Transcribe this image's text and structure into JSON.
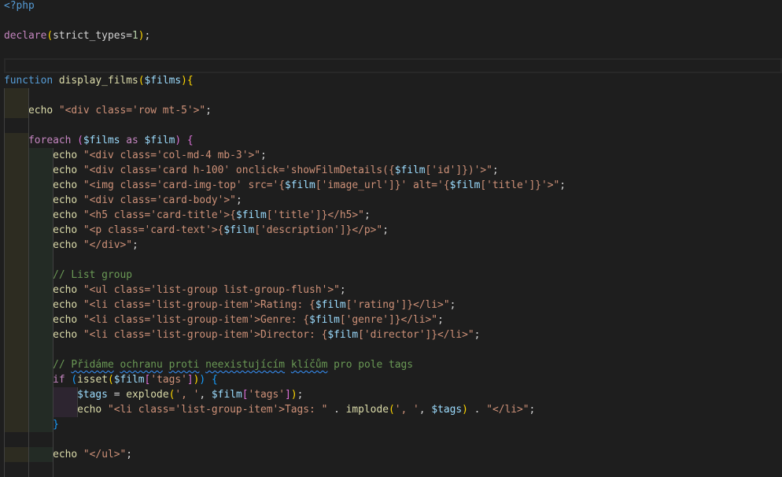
{
  "editor": {
    "current_line": 4,
    "lines": [
      {
        "ind": 0,
        "t": [
          [
            "b",
            "<?php"
          ]
        ]
      },
      {
        "ind": 0,
        "t": []
      },
      {
        "ind": 0,
        "t": [
          [
            "k",
            "declare"
          ],
          [
            "g",
            "("
          ],
          [
            "p",
            "strict_types="
          ],
          [
            "n",
            "1"
          ],
          [
            "g",
            ")"
          ],
          [
            "p",
            ";"
          ]
        ]
      },
      {
        "ind": 0,
        "t": []
      },
      {
        "ind": 0,
        "t": []
      },
      {
        "ind": 0,
        "t": [
          [
            "b",
            "function"
          ],
          [
            "p",
            " "
          ],
          [
            "f",
            "display_films"
          ],
          [
            "g",
            "("
          ],
          [
            "v",
            "$films"
          ],
          [
            "g",
            ")"
          ],
          [
            "g",
            "{"
          ]
        ]
      },
      {
        "ind": 1,
        "t": []
      },
      {
        "ind": 1,
        "t": [
          [
            "p",
            "    "
          ],
          [
            "e",
            "echo"
          ],
          [
            "p",
            " "
          ],
          [
            "s",
            "\"<div class='row mt-5'>\""
          ],
          [
            "p",
            ";"
          ]
        ]
      },
      {
        "ind": 0,
        "t": []
      },
      {
        "ind": 1,
        "t": [
          [
            "p",
            "    "
          ],
          [
            "k",
            "foreach"
          ],
          [
            "p",
            " "
          ],
          [
            "m",
            "("
          ],
          [
            "v",
            "$films"
          ],
          [
            "p",
            " "
          ],
          [
            "k",
            "as"
          ],
          [
            "p",
            " "
          ],
          [
            "v",
            "$film"
          ],
          [
            "m",
            ")"
          ],
          [
            "p",
            " "
          ],
          [
            "m",
            "{"
          ]
        ]
      },
      {
        "ind": 2,
        "t": [
          [
            "p",
            "        "
          ],
          [
            "e",
            "echo"
          ],
          [
            "p",
            " "
          ],
          [
            "s",
            "\"<div class='col-md-4 mb-3'>\""
          ],
          [
            "p",
            ";"
          ]
        ]
      },
      {
        "ind": 2,
        "t": [
          [
            "p",
            "        "
          ],
          [
            "e",
            "echo"
          ],
          [
            "p",
            " "
          ],
          [
            "s",
            "\"<div class='card h-100' onclick='showFilmDetails({"
          ],
          [
            "v",
            "$film"
          ],
          [
            "s",
            "['id']})'>\""
          ],
          [
            "p",
            ";"
          ]
        ]
      },
      {
        "ind": 2,
        "t": [
          [
            "p",
            "        "
          ],
          [
            "e",
            "echo"
          ],
          [
            "p",
            " "
          ],
          [
            "s",
            "\"<img class='card-img-top' src='{"
          ],
          [
            "v",
            "$film"
          ],
          [
            "s",
            "['image_url']}' alt='{"
          ],
          [
            "v",
            "$film"
          ],
          [
            "s",
            "['title']}'>\""
          ],
          [
            "p",
            ";"
          ]
        ]
      },
      {
        "ind": 2,
        "t": [
          [
            "p",
            "        "
          ],
          [
            "e",
            "echo"
          ],
          [
            "p",
            " "
          ],
          [
            "s",
            "\"<div class='card-body'>\""
          ],
          [
            "p",
            ";"
          ]
        ]
      },
      {
        "ind": 2,
        "t": [
          [
            "p",
            "        "
          ],
          [
            "e",
            "echo"
          ],
          [
            "p",
            " "
          ],
          [
            "s",
            "\"<h5 class='card-title'>{"
          ],
          [
            "v",
            "$film"
          ],
          [
            "s",
            "['title']}</h5>\""
          ],
          [
            "p",
            ";"
          ]
        ]
      },
      {
        "ind": 2,
        "t": [
          [
            "p",
            "        "
          ],
          [
            "e",
            "echo"
          ],
          [
            "p",
            " "
          ],
          [
            "s",
            "\"<p class='card-text'>{"
          ],
          [
            "v",
            "$film"
          ],
          [
            "s",
            "['description']}</p>\""
          ],
          [
            "p",
            ";"
          ]
        ]
      },
      {
        "ind": 2,
        "t": [
          [
            "p",
            "        "
          ],
          [
            "e",
            "echo"
          ],
          [
            "p",
            " "
          ],
          [
            "s",
            "\"</div>\""
          ],
          [
            "p",
            ";"
          ]
        ]
      },
      {
        "ind": 2,
        "t": []
      },
      {
        "ind": 2,
        "t": [
          [
            "p",
            "        "
          ],
          [
            "c",
            "// List group"
          ]
        ]
      },
      {
        "ind": 2,
        "t": [
          [
            "p",
            "        "
          ],
          [
            "e",
            "echo"
          ],
          [
            "p",
            " "
          ],
          [
            "s",
            "\"<ul class='list-group list-group-flush'>\""
          ],
          [
            "p",
            ";"
          ]
        ]
      },
      {
        "ind": 2,
        "t": [
          [
            "p",
            "        "
          ],
          [
            "e",
            "echo"
          ],
          [
            "p",
            " "
          ],
          [
            "s",
            "\"<li class='list-group-item'>Rating: {"
          ],
          [
            "v",
            "$film"
          ],
          [
            "s",
            "['rating']}</li>\""
          ],
          [
            "p",
            ";"
          ]
        ]
      },
      {
        "ind": 2,
        "t": [
          [
            "p",
            "        "
          ],
          [
            "e",
            "echo"
          ],
          [
            "p",
            " "
          ],
          [
            "s",
            "\"<li class='list-group-item'>Genre: {"
          ],
          [
            "v",
            "$film"
          ],
          [
            "s",
            "['genre']}</li>\""
          ],
          [
            "p",
            ";"
          ]
        ]
      },
      {
        "ind": 2,
        "t": [
          [
            "p",
            "        "
          ],
          [
            "e",
            "echo"
          ],
          [
            "p",
            " "
          ],
          [
            "s",
            "\"<li class='list-group-item'>Director: {"
          ],
          [
            "v",
            "$film"
          ],
          [
            "s",
            "['director']}</li>\""
          ],
          [
            "p",
            ";"
          ]
        ]
      },
      {
        "ind": 2,
        "t": []
      },
      {
        "ind": 2,
        "t": [
          [
            "p",
            "        "
          ],
          [
            "c",
            "// "
          ],
          [
            "sq",
            "Přidáme"
          ],
          [
            "c",
            " "
          ],
          [
            "sq",
            "ochranu"
          ],
          [
            "c",
            " "
          ],
          [
            "sq",
            "proti"
          ],
          [
            "c",
            " "
          ],
          [
            "sq",
            "neexistujícím"
          ],
          [
            "c",
            " "
          ],
          [
            "sq",
            "klíčům"
          ],
          [
            "c",
            " pro pole tags"
          ]
        ]
      },
      {
        "ind": 2,
        "t": [
          [
            "p",
            "        "
          ],
          [
            "k",
            "if"
          ],
          [
            "p",
            " "
          ],
          [
            "u",
            "("
          ],
          [
            "f",
            "isset"
          ],
          [
            "g",
            "("
          ],
          [
            "v",
            "$film"
          ],
          [
            "m",
            "["
          ],
          [
            "s",
            "'tags'"
          ],
          [
            "m",
            "]"
          ],
          [
            "g",
            ")"
          ],
          [
            "u",
            ")"
          ],
          [
            "p",
            " "
          ],
          [
            "u",
            "{"
          ]
        ]
      },
      {
        "ind": 3,
        "t": [
          [
            "p",
            "            "
          ],
          [
            "v",
            "$tags"
          ],
          [
            "p",
            " = "
          ],
          [
            "f",
            "explode"
          ],
          [
            "g",
            "("
          ],
          [
            "s",
            "', '"
          ],
          [
            "p",
            ", "
          ],
          [
            "v",
            "$film"
          ],
          [
            "m",
            "["
          ],
          [
            "s",
            "'tags'"
          ],
          [
            "m",
            "]"
          ],
          [
            "g",
            ")"
          ],
          [
            "p",
            ";"
          ]
        ]
      },
      {
        "ind": 3,
        "t": [
          [
            "p",
            "            "
          ],
          [
            "e",
            "echo"
          ],
          [
            "p",
            " "
          ],
          [
            "s",
            "\"<li class='list-group-item'>Tags: \""
          ],
          [
            "p",
            " . "
          ],
          [
            "f",
            "implode"
          ],
          [
            "g",
            "("
          ],
          [
            "s",
            "', '"
          ],
          [
            "p",
            ", "
          ],
          [
            "v",
            "$tags"
          ],
          [
            "g",
            ")"
          ],
          [
            "p",
            " . "
          ],
          [
            "s",
            "\"</li>\""
          ],
          [
            "p",
            ";"
          ]
        ]
      },
      {
        "ind": 2,
        "t": [
          [
            "p",
            "        "
          ],
          [
            "u",
            "}"
          ]
        ]
      },
      {
        "ind": 0,
        "t": []
      },
      {
        "ind": 2,
        "t": [
          [
            "p",
            "        "
          ],
          [
            "e",
            "echo"
          ],
          [
            "p",
            " "
          ],
          [
            "s",
            "\"</ul>\""
          ],
          [
            "p",
            ";"
          ]
        ]
      }
    ]
  }
}
